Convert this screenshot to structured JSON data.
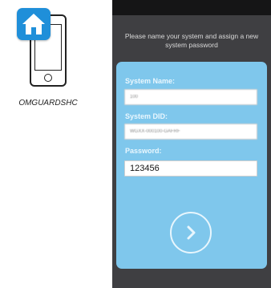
{
  "device": {
    "label": "OMGUARDSHC",
    "home_icon": "home-icon",
    "phone_icon": "smartphone-icon"
  },
  "app": {
    "instruction": "Please name your system and assign a new system password",
    "form": {
      "system_name_label": "System Name:",
      "system_name_value": "100",
      "system_did_label": "System DID:",
      "system_did_value": "WGXX-000100-GAFRF",
      "password_label": "Password:",
      "password_value": "123456",
      "submit_icon": "chevron-right-icon"
    }
  },
  "colors": {
    "accent": "#1f8fd9",
    "card": "#7fc7ec",
    "screen_bg": "#3f3f42"
  }
}
